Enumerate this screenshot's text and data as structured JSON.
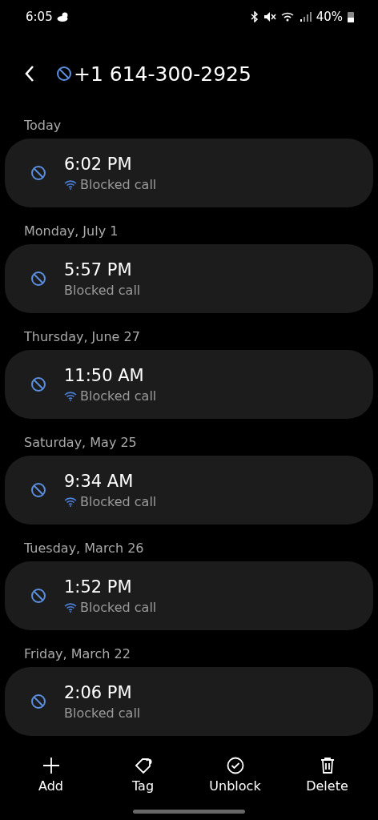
{
  "status_bar": {
    "time": "6:05",
    "battery": "40%"
  },
  "header": {
    "title": "+1 614-300-2925"
  },
  "groups": [
    {
      "date": "Today",
      "calls": [
        {
          "time": "6:02 PM",
          "status": "Blocked call",
          "wifi_call": true
        }
      ]
    },
    {
      "date": "Monday, July 1",
      "calls": [
        {
          "time": "5:57 PM",
          "status": "Blocked call",
          "wifi_call": false
        }
      ]
    },
    {
      "date": "Thursday, June 27",
      "calls": [
        {
          "time": "11:50 AM",
          "status": "Blocked call",
          "wifi_call": true
        }
      ]
    },
    {
      "date": "Saturday, May 25",
      "calls": [
        {
          "time": "9:34 AM",
          "status": "Blocked call",
          "wifi_call": true
        }
      ]
    },
    {
      "date": "Tuesday, March 26",
      "calls": [
        {
          "time": "1:52 PM",
          "status": "Blocked call",
          "wifi_call": true
        }
      ]
    },
    {
      "date": "Friday, March 22",
      "calls": [
        {
          "time": "2:06 PM",
          "status": "Blocked call",
          "wifi_call": false
        }
      ]
    }
  ],
  "actions": [
    {
      "kind": "add",
      "label": "Add"
    },
    {
      "kind": "tag",
      "label": "Tag"
    },
    {
      "kind": "unblock",
      "label": "Unblock"
    },
    {
      "kind": "delete",
      "label": "Delete"
    }
  ]
}
